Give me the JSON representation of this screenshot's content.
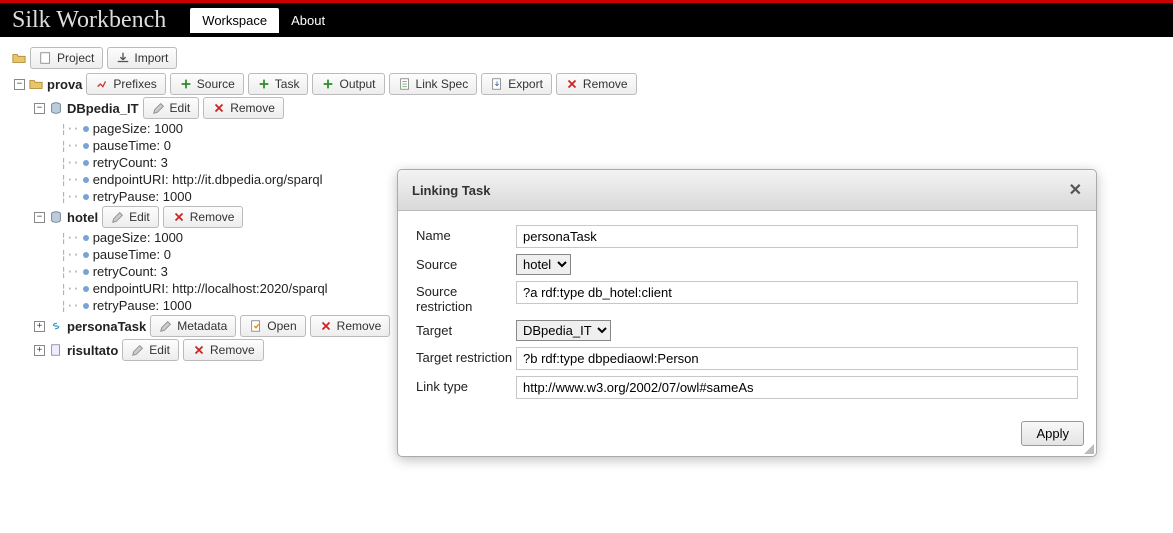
{
  "app": {
    "title": "Silk Workbench"
  },
  "tabs": {
    "workspace": "Workspace",
    "about": "About"
  },
  "topButtons": {
    "project": "Project",
    "import": "Import"
  },
  "project": {
    "name": "prova",
    "buttons": {
      "prefixes": "Prefixes",
      "source": "Source",
      "task": "Task",
      "output": "Output",
      "linkspec": "Link Spec",
      "export": "Export",
      "remove": "Remove"
    }
  },
  "sources": [
    {
      "name": "DBpedia_IT",
      "buttons": {
        "edit": "Edit",
        "remove": "Remove"
      },
      "props": [
        {
          "k": "pageSize",
          "v": "1000"
        },
        {
          "k": "pauseTime",
          "v": "0"
        },
        {
          "k": "retryCount",
          "v": "3"
        },
        {
          "k": "endpointURI",
          "v": "http://it.dbpedia.org/sparql"
        },
        {
          "k": "retryPause",
          "v": "1000"
        }
      ]
    },
    {
      "name": "hotel",
      "buttons": {
        "edit": "Edit",
        "remove": "Remove"
      },
      "props": [
        {
          "k": "pageSize",
          "v": "1000"
        },
        {
          "k": "pauseTime",
          "v": "0"
        },
        {
          "k": "retryCount",
          "v": "3"
        },
        {
          "k": "endpointURI",
          "v": "http://localhost:2020/sparql"
        },
        {
          "k": "retryPause",
          "v": "1000"
        }
      ]
    }
  ],
  "task": {
    "name": "personaTask",
    "buttons": {
      "metadata": "Metadata",
      "open": "Open",
      "remove": "Remove"
    }
  },
  "result": {
    "name": "risultato",
    "buttons": {
      "edit": "Edit",
      "remove": "Remove"
    }
  },
  "modal": {
    "title": "Linking Task",
    "labels": {
      "name": "Name",
      "source": "Source",
      "sourceRestriction": "Source restriction",
      "target": "Target",
      "targetRestriction": "Target restriction",
      "linkType": "Link type"
    },
    "values": {
      "name": "personaTask",
      "source": "hotel",
      "sourceRestriction": "?a rdf:type db_hotel:client",
      "target": "DBpedia_IT",
      "targetRestriction": "?b rdf:type dbpediaowl:Person",
      "linkType": "http://www.w3.org/2002/07/owl#sameAs"
    },
    "apply": "Apply"
  }
}
